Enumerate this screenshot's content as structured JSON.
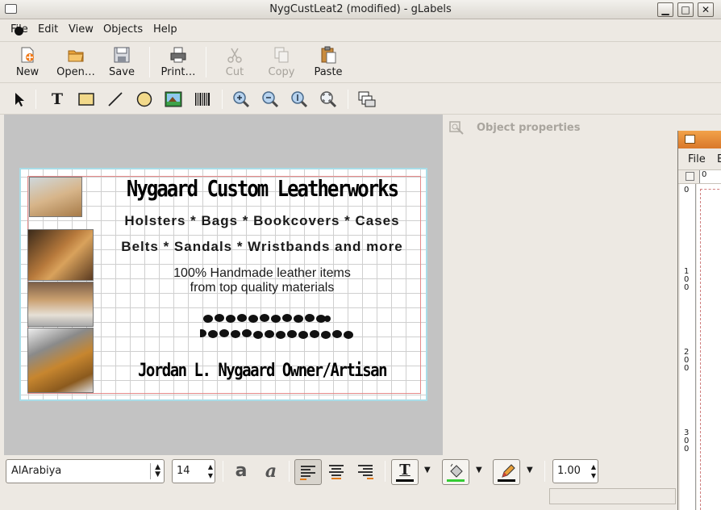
{
  "window": {
    "title": "NygCustLeat2 (modified) - gLabels"
  },
  "window_buttons": {
    "minimize": "▁",
    "maximize": "□",
    "close": "✕"
  },
  "menu": {
    "file": "File",
    "edit": "Edit",
    "view": "View",
    "objects": "Objects",
    "help": "Help"
  },
  "toolbar": {
    "new": "New",
    "open": "Open…",
    "save": "Save",
    "print": "Print…",
    "cut": "Cut",
    "copy": "Copy",
    "paste": "Paste"
  },
  "tools": {
    "text_glyph": "T"
  },
  "label": {
    "title": "Nygaard Custom Leatherworks",
    "line1": "Holsters * Bags * Bookcovers * Cases",
    "line2": "Belts * Sandals * Wristbands and more",
    "line3": "100% Handmade leather items",
    "line4": "from top quality materials",
    "owner": "Jordan L. Nygaard Owner/Artisan"
  },
  "properties": {
    "header": "Object properties"
  },
  "second_window": {
    "menu_file": "File",
    "menu_e": "E",
    "ruler_0": "0",
    "ruler_v0": "0",
    "ruler_100": "1\n0\n0",
    "ruler_200": "2\n0\n0",
    "ruler_300": "3\n0\n0"
  },
  "format_bar": {
    "font_family": "AlArabiya",
    "font_size": "14",
    "line_width": "1.00",
    "text_color_glyph": "T",
    "bold_glyph": "a",
    "italic_glyph": "a"
  },
  "colors": {
    "text_color": "#000000",
    "fill_color": "#33cc33",
    "line_color": "#000000"
  }
}
